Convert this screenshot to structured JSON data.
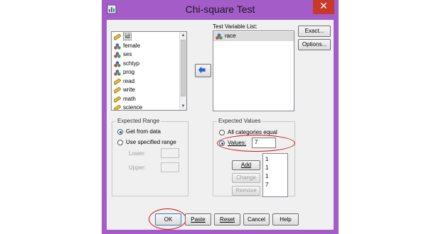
{
  "window": {
    "title": "Chi-square Test",
    "close_label": "✕",
    "accent_color": "#a35cc8",
    "close_color": "#c7392b"
  },
  "variables": {
    "items": [
      {
        "label": "id",
        "icon": "scale-icon",
        "selected": true
      },
      {
        "label": "female",
        "icon": "nominal-icon",
        "selected": false
      },
      {
        "label": "ses",
        "icon": "nominal-icon",
        "selected": false
      },
      {
        "label": "schtyp",
        "icon": "nominal-icon",
        "selected": false
      },
      {
        "label": "prog",
        "icon": "nominal-icon",
        "selected": false
      },
      {
        "label": "read",
        "icon": "scale-icon",
        "selected": false
      },
      {
        "label": "write",
        "icon": "scale-icon",
        "selected": false
      },
      {
        "label": "math",
        "icon": "scale-icon",
        "selected": false
      },
      {
        "label": "science",
        "icon": "scale-icon",
        "selected": false
      }
    ]
  },
  "test_variable_list": {
    "label": "Test Variable List:",
    "items": [
      {
        "label": "race",
        "icon": "nominal-icon"
      }
    ]
  },
  "side_buttons": {
    "exact": "Exact...",
    "options": "Options..."
  },
  "expected_range": {
    "title": "Expected Range",
    "get_from_data": "Get from data",
    "use_specified_range": "Use specified range",
    "lower_label": "Lower:",
    "upper_label": "Upper:",
    "selected": "get_from_data"
  },
  "expected_values": {
    "title": "Expected Values",
    "all_categories_equal": "All categories equal",
    "values_label": "Values:",
    "values_input": "7",
    "selected": "values",
    "add": "Add",
    "change": "Change",
    "remove": "Remove",
    "list": [
      "1",
      "1",
      "1",
      "7"
    ]
  },
  "footer_buttons": {
    "ok": "OK",
    "paste": "Paste",
    "reset": "Reset",
    "cancel": "Cancel",
    "help": "Help"
  },
  "annotation_color": "#d0121b"
}
